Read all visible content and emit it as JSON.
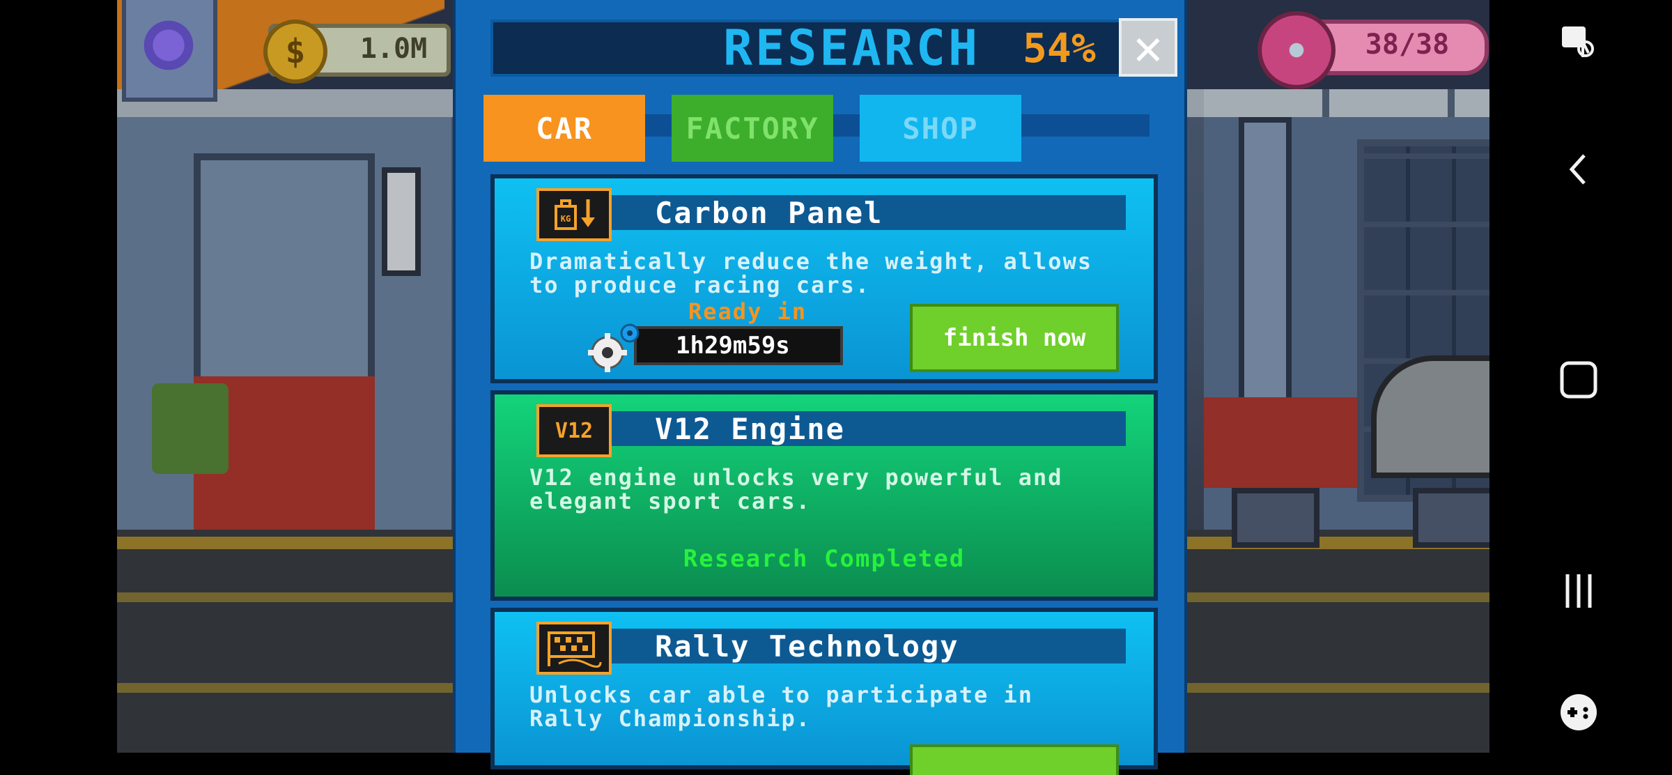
{
  "hud": {
    "money": "1.0M",
    "coin_symbol": "$",
    "donuts": "38/38"
  },
  "research": {
    "title": "RESEARCH",
    "percent": "54%",
    "close_symbol": "✕",
    "tabs": [
      {
        "label": "CAR",
        "active": true
      },
      {
        "label": "FACTORY",
        "active": false
      },
      {
        "label": "SHOP",
        "active": false
      }
    ],
    "items": [
      {
        "title": "Carbon Panel",
        "icon": "weight-down-icon",
        "description_line1": "Dramatically reduce the weight, allows",
        "description_line2": "to produce racing cars.",
        "ready_label": "Ready in",
        "timer": "1h29m59s",
        "action": "finish now"
      },
      {
        "title": "V12 Engine",
        "icon": "v12-engine-icon",
        "icon_text": "V12",
        "description_line1": "V12 engine unlocks very powerful and",
        "description_line2": "elegant sport cars.",
        "status": "Research Completed"
      },
      {
        "title": "Rally Technology",
        "icon": "rally-flag-icon",
        "description_line1": "Unlocks car able to participate in",
        "description_line2": "Rally Championship."
      }
    ]
  },
  "colors": {
    "panel_bg": "#1269b8",
    "title_blue": "#1fb7f2",
    "percent_orange": "#f39a1d",
    "tab_car": "#f7931e",
    "tab_factory": "#3dae2b",
    "tab_shop": "#11b6ef",
    "completed_green": "#26f23c"
  }
}
